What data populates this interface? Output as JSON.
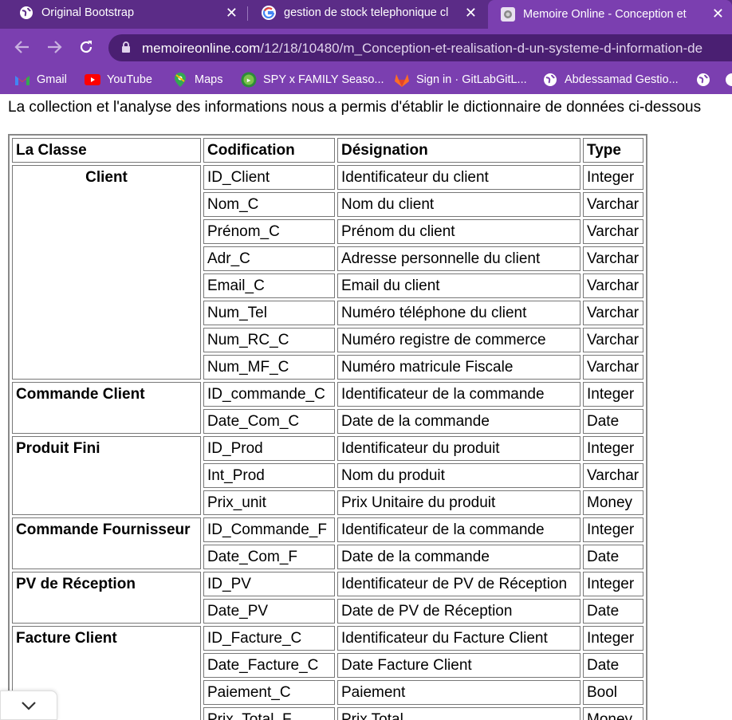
{
  "tabs": [
    {
      "title": "Original Bootstrap",
      "icon": "globe-icon"
    },
    {
      "title": "gestion de stock telephonique cl",
      "icon": "google-icon"
    },
    {
      "title": "Memoire Online - Conception et",
      "icon": "memoire-online-icon",
      "active": true
    }
  ],
  "address_bar": {
    "host": "memoireonline.com",
    "path": "/12/18/10480/m_Conception-et-realisation-d-un-systeme-d-information-de"
  },
  "bookmarks": [
    {
      "label": "Gmail",
      "icon": "gmail-icon"
    },
    {
      "label": "YouTube",
      "icon": "youtube-icon"
    },
    {
      "label": "Maps",
      "icon": "maps-icon"
    },
    {
      "label": "SPY x FAMILY Seaso...",
      "icon": "anime-icon"
    },
    {
      "label": "Sign in · GitLabGitL...",
      "icon": "gitlab-icon"
    },
    {
      "label": "Abdessamad Gestio...",
      "icon": "globe-icon"
    }
  ],
  "page": {
    "intro": "La collection et l'analyse des informations nous a permis d'établir le dictionnaire de données ci-dessous",
    "table": {
      "headers": [
        "La Classe",
        "Codification",
        "Désignation",
        "Type"
      ],
      "groups": [
        {
          "class": "Client",
          "rows": [
            [
              "ID_Client",
              "Identificateur du client",
              "Integer"
            ],
            [
              "Nom_C",
              "Nom du client",
              "Varchar"
            ],
            [
              "Prénom_C",
              "Prénom du client",
              "Varchar"
            ],
            [
              "Adr_C",
              "Adresse personnelle du client",
              "Varchar"
            ],
            [
              "Email_C",
              "Email du client",
              "Varchar"
            ],
            [
              "Num_Tel",
              "Numéro téléphone du client",
              "Varchar"
            ],
            [
              "Num_RC_C",
              "Numéro registre de commerce",
              "Varchar"
            ],
            [
              "Num_MF_C",
              "Numéro matricule Fiscale",
              "Varchar"
            ]
          ]
        },
        {
          "class": "Commande Client",
          "rows": [
            [
              "ID_commande_C",
              "Identificateur de la commande",
              "Integer"
            ],
            [
              "Date_Com_C",
              "Date de la commande",
              "Date"
            ]
          ]
        },
        {
          "class": "Produit Fini",
          "rows": [
            [
              "ID_Prod",
              "Identificateur du produit",
              "Integer"
            ],
            [
              "Int_Prod",
              "Nom du produit",
              "Varchar"
            ],
            [
              "Prix_unit",
              "Prix Unitaire du produit",
              "Money"
            ]
          ]
        },
        {
          "class": "Commande Fournisseur",
          "rows": [
            [
              "ID_Commande_F",
              "Identificateur de la commande",
              "Integer"
            ],
            [
              "Date_Com_F",
              "Date de la commande",
              "Date"
            ]
          ]
        },
        {
          "class": "PV de Réception",
          "rows": [
            [
              "ID_PV",
              "Identificateur de PV de Réception",
              "Integer"
            ],
            [
              "Date_PV",
              "Date de PV de Réception",
              "Date"
            ]
          ]
        },
        {
          "class": "Facture Client",
          "rows": [
            [
              "ID_Facture_C",
              "Identificateur du Facture Client",
              "Integer"
            ],
            [
              "Date_Facture_C",
              "Date Facture Client",
              "Date"
            ],
            [
              "Paiement_C",
              "Paiement",
              "Bool"
            ],
            [
              "Prix_Total_F",
              "Prix Total",
              "Money"
            ]
          ]
        }
      ]
    }
  },
  "colors": {
    "tabstrip": "#5b2c87",
    "toolbar": "#7b3fb0",
    "omnibox": "#4a1f72"
  }
}
